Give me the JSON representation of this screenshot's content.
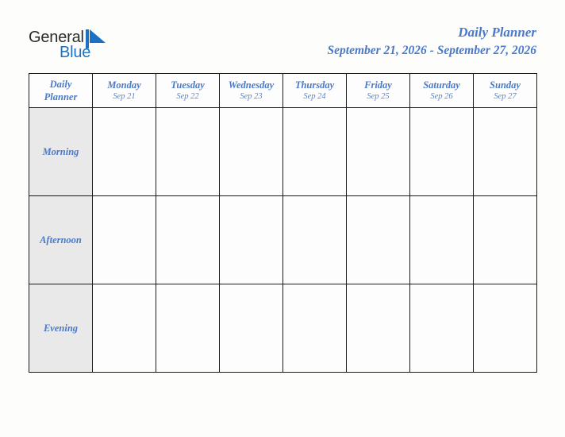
{
  "brand": {
    "name_part1": "General",
    "name_part2": "Blue",
    "mark": "blue-triangle-flag-icon"
  },
  "header": {
    "title": "Daily Planner",
    "date_range": "September 21, 2026 - September 27, 2026"
  },
  "colors": {
    "accent_blue": "#4a79c9",
    "logo_blue": "#1b72c4",
    "header_green": "#dfe9d0",
    "row_label_gray": "#e9e9e9",
    "grid_line": "#1a1a1a",
    "page_background": "#fdfdfb"
  },
  "table": {
    "corner": {
      "line1": "Daily",
      "line2": "Planner"
    },
    "columns": [
      {
        "day": "Monday",
        "date": "Sep 21"
      },
      {
        "day": "Tuesday",
        "date": "Sep 22"
      },
      {
        "day": "Wednesday",
        "date": "Sep 23"
      },
      {
        "day": "Thursday",
        "date": "Sep 24"
      },
      {
        "day": "Friday",
        "date": "Sep 25"
      },
      {
        "day": "Saturday",
        "date": "Sep 26"
      },
      {
        "day": "Sunday",
        "date": "Sep 27"
      }
    ],
    "rows": [
      {
        "label": "Morning",
        "cells": [
          "",
          "",
          "",
          "",
          "",
          "",
          ""
        ]
      },
      {
        "label": "Afternoon",
        "cells": [
          "",
          "",
          "",
          "",
          "",
          "",
          ""
        ]
      },
      {
        "label": "Evening",
        "cells": [
          "",
          "",
          "",
          "",
          "",
          "",
          ""
        ]
      }
    ]
  }
}
